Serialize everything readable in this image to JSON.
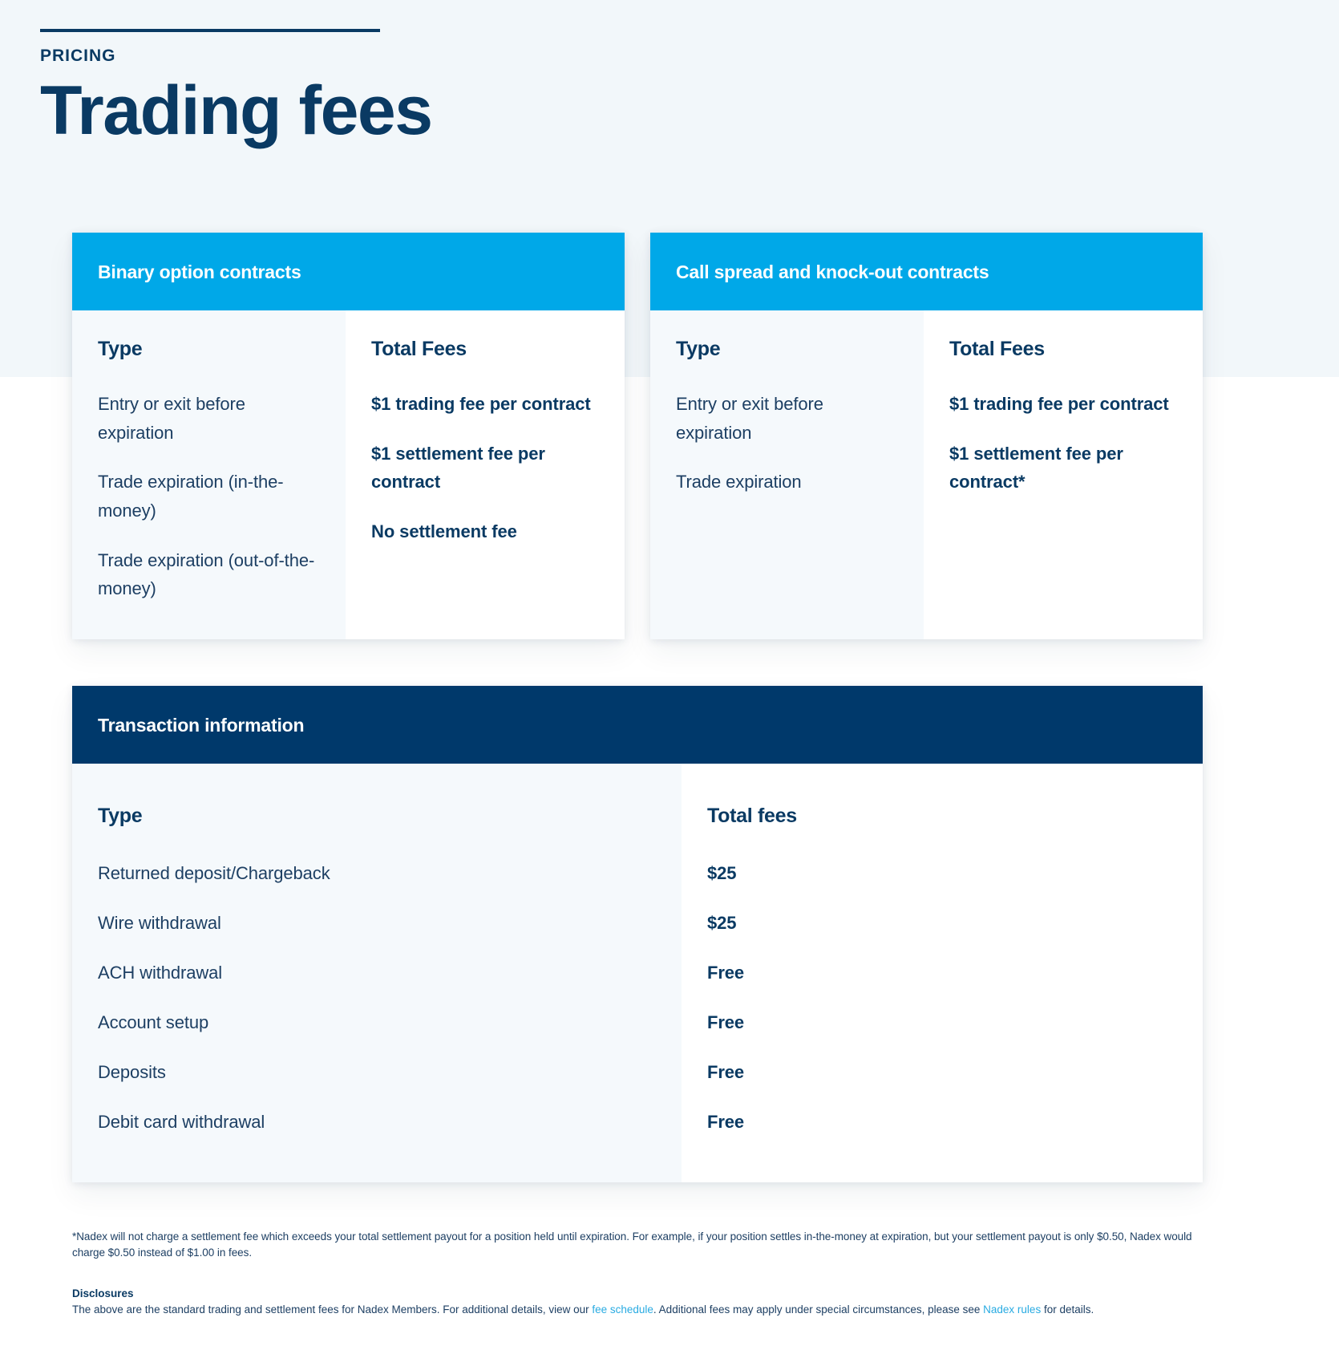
{
  "hero": {
    "eyebrow": "PRICING",
    "title": "Trading fees"
  },
  "colors": {
    "navy": "#0a3a63",
    "cyan_header": "#00a8e8",
    "dark_header": "#00396b",
    "hero_bg": "#f2f7fa",
    "col_tint": "#f5f9fc",
    "link": "#29abe2"
  },
  "cards": [
    {
      "title": "Binary option contracts",
      "header_style": "cyan",
      "col_type_header": "Type",
      "col_fees_header": "Total Fees",
      "types": [
        "Entry or exit before expiration",
        "Trade expiration (in-the-money)",
        "Trade expiration (out-of-the-money)"
      ],
      "fees": [
        "$1 trading fee per contract",
        "$1 settlement fee per contract",
        "No settlement fee"
      ]
    },
    {
      "title": "Call spread and knock-out contracts",
      "header_style": "cyan",
      "col_type_header": "Type",
      "col_fees_header": "Total Fees",
      "types": [
        "Entry or exit before expiration",
        "Trade expiration"
      ],
      "fees": [
        "$1 trading fee per contract",
        "$1 settlement fee per contract*"
      ]
    }
  ],
  "transaction_card": {
    "title": "Transaction information",
    "header_style": "navy",
    "col_type_header": "Type",
    "col_fees_header": "Total fees",
    "rows": [
      {
        "type": "Returned deposit/Chargeback",
        "fee": "$25"
      },
      {
        "type": "Wire withdrawal",
        "fee": "$25"
      },
      {
        "type": "ACH withdrawal",
        "fee": "Free"
      },
      {
        "type": "Account setup",
        "fee": "Free"
      },
      {
        "type": "Deposits",
        "fee": "Free"
      },
      {
        "type": "Debit card withdrawal",
        "fee": "Free"
      }
    ]
  },
  "footnotes": {
    "asterisk": "*Nadex will not charge a settlement fee which exceeds your total settlement payout for a position held until expiration. For example, if your position settles in-the-money at expiration, but your settlement payout is only $0.50, Nadex would charge $0.50 instead of $1.00 in fees.",
    "disclosures_title": "Disclosures",
    "disclosures_part1": "The above are the standard trading and settlement fees for Nadex Members. For additional details, view our ",
    "disclosures_link1": "fee schedule",
    "disclosures_part2": ". Additional fees may apply under special circumstances, please see ",
    "disclosures_link2": "Nadex rules",
    "disclosures_part3": " for details."
  }
}
